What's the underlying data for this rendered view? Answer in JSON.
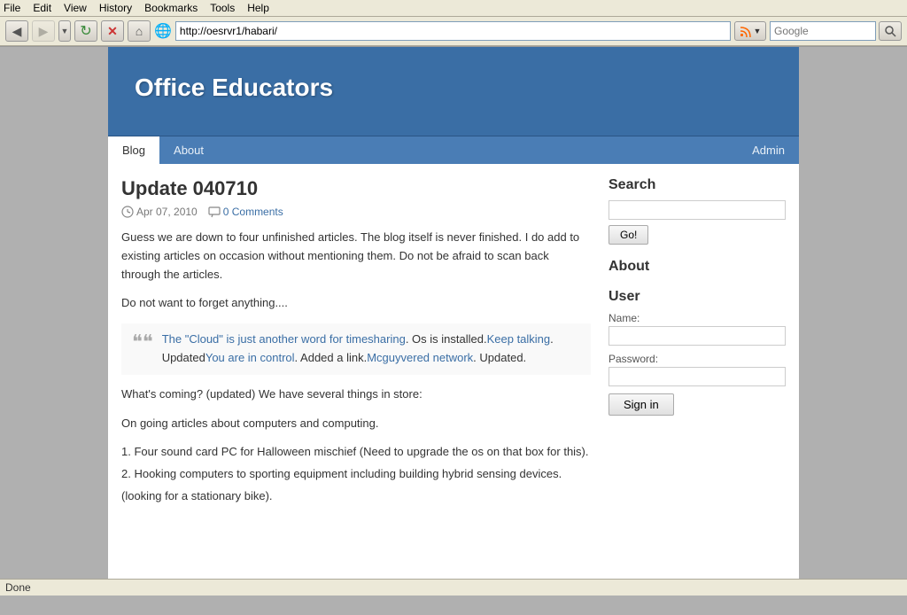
{
  "browser": {
    "menu": {
      "file": "File",
      "edit": "Edit",
      "view": "View",
      "history": "History",
      "bookmarks": "Bookmarks",
      "tools": "Tools",
      "help": "Help"
    },
    "address": "http://oesrvr1/habari/",
    "search_placeholder": "Google",
    "status": "Done"
  },
  "site": {
    "title": "Office Educators",
    "nav": {
      "blog": "Blog",
      "about": "About",
      "admin": "Admin"
    }
  },
  "post": {
    "title": "Update 040710",
    "date": "Apr 07, 2010",
    "comments": "0 Comments",
    "body_1": "Guess we are down to four unfinished articles. The blog itself is never finished. I do add to existing articles on occasion without mentioning them. Do not be afraid to scan back through the articles.",
    "body_2": "Do not want to forget anything....",
    "quote_link1": "The \"Cloud\" is just another word for timesharing",
    "quote_text1": ". Os is installed.",
    "quote_link2": "Keep talking",
    "quote_text2": ". Updated",
    "quote_link3": "You are in control",
    "quote_text3": ". Added a link.",
    "quote_link4": "Mcguyvered network",
    "quote_text4": ". Updated.",
    "body_3": "What's coming? (updated) We have several things in store:",
    "body_4": "On going articles about computers and computing.",
    "item1_text": "1. Four sound card PC for Halloween mischief (Need to upgrade the os on that box for this).",
    "item2_text": "2. Hooking computers to sporting equipment including building hybrid sensing devices.",
    "item3_text": "(looking for a stationary bike)."
  },
  "sidebar": {
    "search_title": "Search",
    "search_go": "Go!",
    "about_title": "About",
    "user_title": "User",
    "name_label": "Name:",
    "password_label": "Password:",
    "signin_label": "Sign in"
  }
}
